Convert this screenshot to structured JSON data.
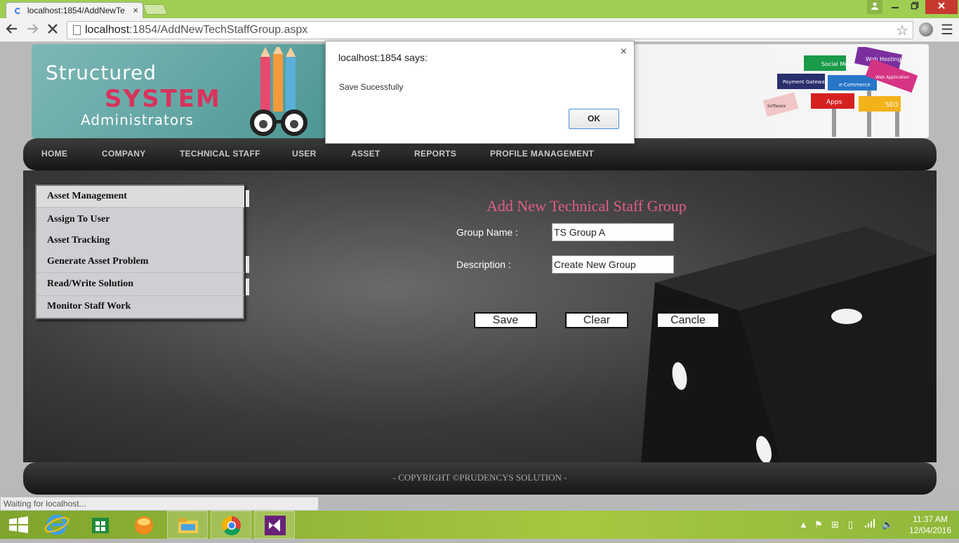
{
  "browser": {
    "tab_title": "localhost:1854/AddNewTe",
    "tab_close": "×",
    "url_host": "localhost",
    "url_rest": ":1854/AddNewTechStaffGroup.aspx",
    "status_text": "Waiting for localhost..."
  },
  "banner": {
    "logo_line1": "Structured",
    "logo_line2": "SYSTEM",
    "logo_line3": "Administrators",
    "signs": [
      "Social Media",
      "Web Hosting",
      "Payment Gateways",
      "e-Commerce",
      "Web Application Development",
      "Software Development",
      "Apps",
      "SEO"
    ]
  },
  "nav": {
    "items": [
      "HOME",
      "COMPANY",
      "TECHNICAL STAFF",
      "USER",
      "ASSET",
      "REPORTS",
      "PROFILE MANAGEMENT"
    ]
  },
  "sidebar": {
    "header": "Asset Management",
    "items": [
      "Assign To User",
      "Asset Tracking",
      "Generate Asset Problem",
      "Read/Write Solution",
      "Monitor Staff Work"
    ]
  },
  "form": {
    "title": "Add New Technical Staff Group",
    "group_name_label": "Group Name :",
    "group_name_value": "TS Group A",
    "description_label": "Description :",
    "description_value": "Create New Group",
    "save": "Save",
    "clear": "Clear",
    "cancel": "Cancle"
  },
  "footer": {
    "text": "- COPYRIGHT ©PRUDENCYS SOLUTION -"
  },
  "dialog": {
    "title": "localhost:1854 says:",
    "message": "Save Sucessfully",
    "ok": "OK",
    "close": "×"
  },
  "taskbar": {
    "time": "11:37 AM",
    "date": "12/04/2016",
    "apps": [
      "start-icon",
      "internet-explorer-icon",
      "store-icon",
      "orange-app-icon",
      "file-explorer-icon",
      "chrome-icon",
      "visual-studio-icon"
    ]
  }
}
